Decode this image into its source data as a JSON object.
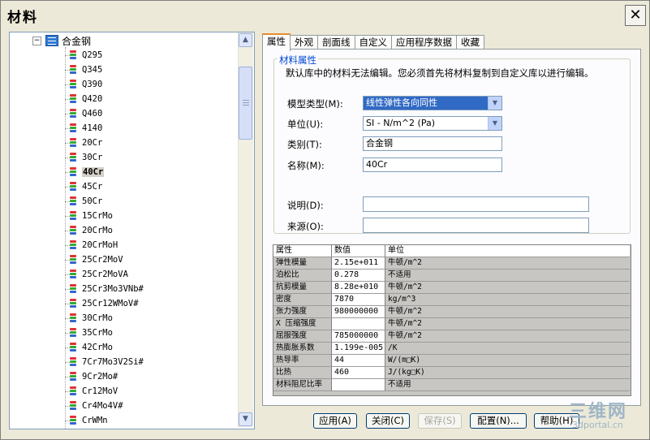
{
  "window": {
    "title": "材料",
    "close_label": "✕"
  },
  "tree": {
    "root_label": "合金钢",
    "expander": "−",
    "selected": "40Cr",
    "items": [
      "Q295",
      "Q345",
      "Q390",
      "Q420",
      "Q460",
      "4140",
      "20Cr",
      "30Cr",
      "40Cr",
      "45Cr",
      "50Cr",
      "15CrMo",
      "20CrMo",
      "20CrMoH",
      "25Cr2MoV",
      "25Cr2MoVA",
      "25Cr3Mo3VNb#",
      "25Cr12WMoV#",
      "30CrMo",
      "35CrMo",
      "42CrMo",
      "7Cr7Mo3V2Si#",
      "9Cr2Mo#",
      "Cr12MoV",
      "Cr4Mo4V#",
      "CrWMn"
    ],
    "scroll_up": "▲",
    "scroll_down": "▼"
  },
  "tabs": [
    "属性",
    "外观",
    "剖面线",
    "自定义",
    "应用程序数据",
    "收藏"
  ],
  "properties": {
    "group_title": "材料属性",
    "notice": "默认库中的材料无法编辑。您必须首先将材料复制到自定义库以进行编辑。",
    "model_type_label": "模型类型(M):",
    "model_type_value": "线性弹性各向同性",
    "units_label": "单位(U):",
    "units_value": "SI - N/m^2 (Pa)",
    "category_label": "类别(T):",
    "category_value": "合金钢",
    "name_label": "名称(M):",
    "name_value": "40Cr",
    "description_label": "说明(D):",
    "description_value": "",
    "source_label": "来源(O):",
    "source_value": ""
  },
  "table": {
    "headers": [
      "属性",
      "数值",
      "单位"
    ],
    "rows": [
      [
        "弹性模量",
        "2.15e+011",
        "牛顿/m^2"
      ],
      [
        "泊松比",
        "0.278",
        "不适用"
      ],
      [
        "抗剪模量",
        "8.28e+010",
        "牛顿/m^2"
      ],
      [
        "密度",
        "7870",
        "kg/m^3"
      ],
      [
        "张力强度",
        "980000000",
        "牛顿/m^2"
      ],
      [
        "X 压缩强度",
        "",
        "牛顿/m^2"
      ],
      [
        "屈服强度",
        "785000000",
        "牛顿/m^2"
      ],
      [
        "热膨胀系数",
        "1.199e-005",
        "/K"
      ],
      [
        "热导率",
        "44",
        "W/(m□K)"
      ],
      [
        "比热",
        "460",
        "J/(kg□K)"
      ],
      [
        "材料阻尼比率",
        "",
        "不适用"
      ]
    ]
  },
  "buttons": {
    "apply": "应用(A)",
    "close": "关闭(C)",
    "save": "保存(S)",
    "config": "配置(N)...",
    "help": "帮助(H)"
  },
  "watermark": {
    "main": "三维网",
    "sub": "3dportal.cn"
  },
  "colors": {
    "accent_tab": "#e68b2c",
    "group_title": "#0046d5",
    "selection": "#316ac5"
  }
}
